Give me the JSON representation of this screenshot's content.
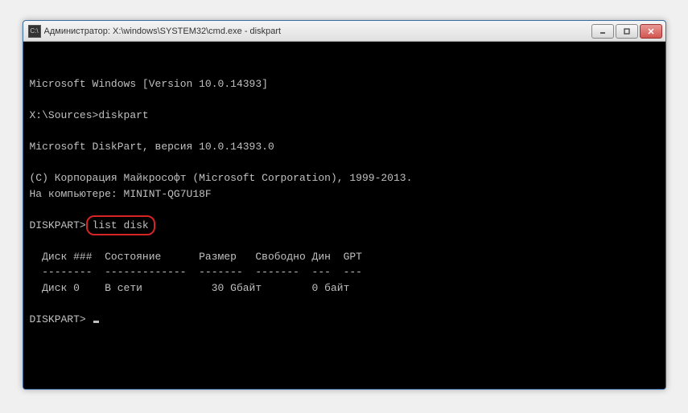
{
  "window": {
    "title": "Администратор: X:\\windows\\SYSTEM32\\cmd.exe - diskpart"
  },
  "terminal": {
    "line1": "Microsoft Windows [Version 10.0.14393]",
    "blank": "",
    "line3a": "X:\\Sources>",
    "line3b": "diskpart",
    "line5": "Microsoft DiskPart, версия 10.0.14393.0",
    "line7": "(C) Корпорация Майкрософт (Microsoft Corporation), 1999-2013.",
    "line8": "На компьютере: MININT-QG7U18F",
    "line10a": "DISKPART> ",
    "cmd": "list disk",
    "tableHeader": "  Диск ###  Состояние      Размер   Свободно Дин  GPT",
    "tableDivider": "  --------  -------------  -------  -------  ---  ---",
    "tableRow": "  Диск 0    В сети           30 Gбайт        0 байт",
    "prompt2": "DISKPART> "
  }
}
